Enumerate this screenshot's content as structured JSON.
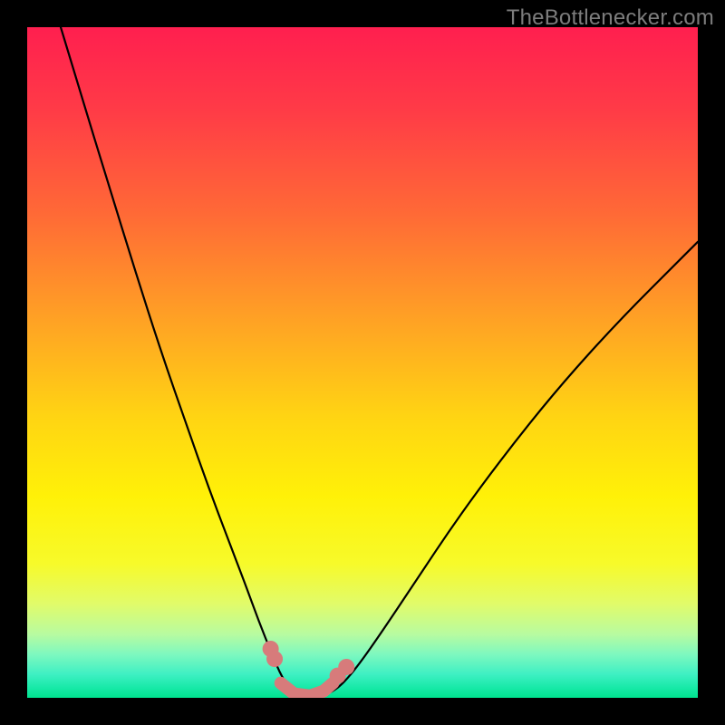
{
  "watermark": {
    "text": "TheBottlenecker.com"
  },
  "chart_data": {
    "type": "line",
    "title": "",
    "xlabel": "",
    "ylabel": "",
    "xlim": [
      0,
      100
    ],
    "ylim": [
      0,
      100
    ],
    "grid": false,
    "legend": false,
    "gradient_stops": [
      {
        "offset": 0.0,
        "color": "#ff1f4f"
      },
      {
        "offset": 0.12,
        "color": "#ff3a47"
      },
      {
        "offset": 0.28,
        "color": "#ff6a36"
      },
      {
        "offset": 0.44,
        "color": "#ffa324"
      },
      {
        "offset": 0.58,
        "color": "#ffd413"
      },
      {
        "offset": 0.7,
        "color": "#fff108"
      },
      {
        "offset": 0.8,
        "color": "#f7fa2a"
      },
      {
        "offset": 0.86,
        "color": "#e1fb6a"
      },
      {
        "offset": 0.905,
        "color": "#b8fba0"
      },
      {
        "offset": 0.935,
        "color": "#7ef8bf"
      },
      {
        "offset": 0.965,
        "color": "#3ef0c3"
      },
      {
        "offset": 0.985,
        "color": "#17e9a7"
      },
      {
        "offset": 1.0,
        "color": "#00e38f"
      }
    ],
    "series": [
      {
        "name": "bottleneck-curve",
        "stroke": "#000000",
        "stroke_width": 2.2,
        "points": [
          {
            "x": 5.0,
            "y": 100.0
          },
          {
            "x": 8.0,
            "y": 90.0
          },
          {
            "x": 12.0,
            "y": 77.0
          },
          {
            "x": 16.0,
            "y": 64.0
          },
          {
            "x": 20.0,
            "y": 51.5
          },
          {
            "x": 24.0,
            "y": 40.0
          },
          {
            "x": 27.0,
            "y": 31.5
          },
          {
            "x": 30.0,
            "y": 23.5
          },
          {
            "x": 32.5,
            "y": 17.0
          },
          {
            "x": 34.5,
            "y": 11.5
          },
          {
            "x": 36.5,
            "y": 6.5
          },
          {
            "x": 38.0,
            "y": 3.0
          },
          {
            "x": 39.5,
            "y": 1.0
          },
          {
            "x": 41.0,
            "y": 0.3
          },
          {
            "x": 43.0,
            "y": 0.2
          },
          {
            "x": 45.0,
            "y": 0.6
          },
          {
            "x": 47.0,
            "y": 2.0
          },
          {
            "x": 49.5,
            "y": 5.0
          },
          {
            "x": 53.0,
            "y": 10.0
          },
          {
            "x": 58.0,
            "y": 17.5
          },
          {
            "x": 64.0,
            "y": 26.5
          },
          {
            "x": 71.0,
            "y": 36.0
          },
          {
            "x": 79.0,
            "y": 46.0
          },
          {
            "x": 88.0,
            "y": 56.0
          },
          {
            "x": 98.0,
            "y": 66.0
          },
          {
            "x": 100.0,
            "y": 68.0
          }
        ]
      },
      {
        "name": "highlight-markers",
        "stroke": "#d77b7b",
        "marker_fill": "#d77b7b",
        "marker_radius_px": 9,
        "cap_stroke_width": 14,
        "points": [
          {
            "x": 36.3,
            "y": 7.3
          },
          {
            "x": 36.9,
            "y": 5.8
          },
          {
            "x": 46.3,
            "y": 3.3
          },
          {
            "x": 47.6,
            "y": 4.6
          }
        ],
        "cap_path": [
          {
            "x": 37.8,
            "y": 2.2
          },
          {
            "x": 39.8,
            "y": 0.6
          },
          {
            "x": 42.2,
            "y": 0.3
          },
          {
            "x": 44.2,
            "y": 1.0
          },
          {
            "x": 45.6,
            "y": 2.2
          }
        ]
      }
    ]
  }
}
